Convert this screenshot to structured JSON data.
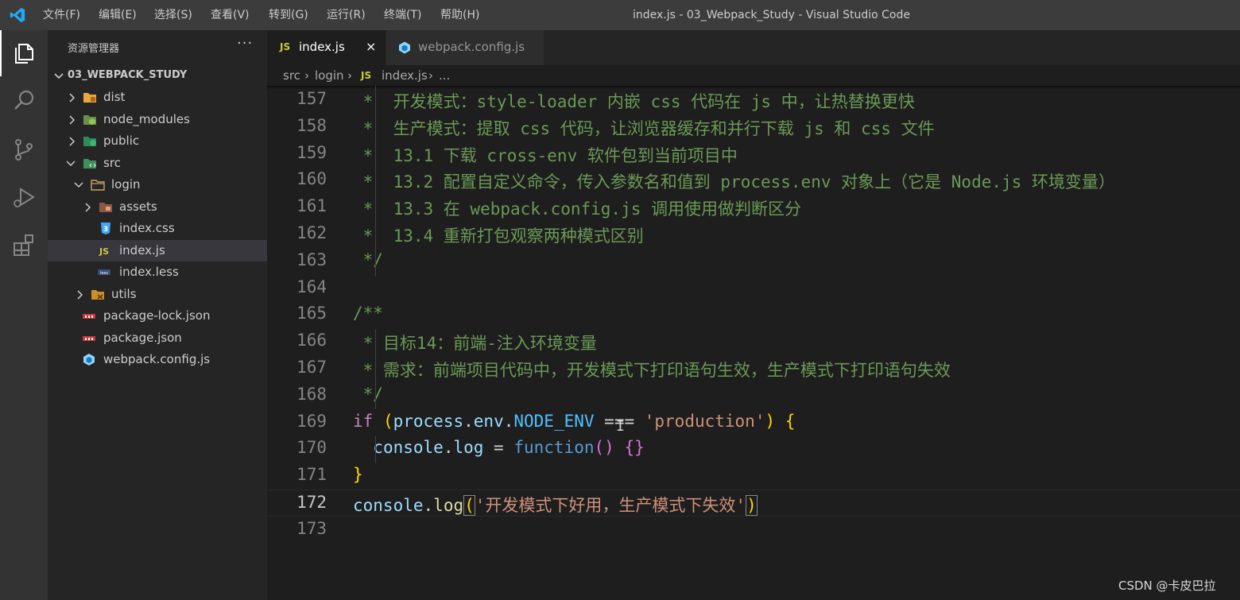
{
  "window": {
    "title": "index.js - 03_Webpack_Study - Visual Studio Code",
    "menu": [
      "文件(F)",
      "编辑(E)",
      "选择(S)",
      "查看(V)",
      "转到(G)",
      "运行(R)",
      "终端(T)",
      "帮助(H)"
    ]
  },
  "activity_bar": [
    "files-icon",
    "search-icon",
    "source-control-icon",
    "run-debug-icon",
    "extensions-icon"
  ],
  "sidebar": {
    "title": "资源管理器",
    "more": "···",
    "project": "03_WEBPACK_STUDY",
    "tree": [
      {
        "label": "dist",
        "icon": "folder-dist-icon",
        "expanded": false
      },
      {
        "label": "node_modules",
        "icon": "folder-node-icon",
        "expanded": false
      },
      {
        "label": "public",
        "icon": "folder-public-icon",
        "expanded": false
      },
      {
        "label": "src",
        "icon": "folder-src-icon",
        "expanded": true
      },
      {
        "label": "login",
        "icon": "folder-icon",
        "expanded": true
      },
      {
        "label": "assets",
        "icon": "folder-assets-icon",
        "expanded": false
      },
      {
        "label": "index.css",
        "icon": "css-file-icon"
      },
      {
        "label": "index.js",
        "icon": "js-file-icon",
        "selected": true
      },
      {
        "label": "index.less",
        "icon": "less-file-icon"
      },
      {
        "label": "utils",
        "icon": "folder-utils-icon",
        "expanded": false
      },
      {
        "label": "package-lock.json",
        "icon": "npm-file-icon"
      },
      {
        "label": "package.json",
        "icon": "npm-file-icon"
      },
      {
        "label": "webpack.config.js",
        "icon": "webpack-file-icon"
      }
    ]
  },
  "tabs": [
    {
      "badge": "JS",
      "label": "index.js",
      "active": true,
      "close": "×"
    },
    {
      "label": "webpack.config.js",
      "active": false
    }
  ],
  "breadcrumb": {
    "items": [
      "src",
      "login",
      "index.js",
      "..."
    ],
    "file_badge": "JS",
    "separator": "›"
  },
  "editor": {
    "current_line": 172,
    "lines": [
      {
        "n": "157",
        "text": " *  开发模式：style-loader 内嵌 css 代码在 js 中，让热替换更快"
      },
      {
        "n": "158",
        "text": " *  生产模式：提取 css 代码，让浏览器缓存和并行下载 js 和 css 文件"
      },
      {
        "n": "159",
        "text": " *  13.1 下载 cross-env 软件包到当前项目中"
      },
      {
        "n": "160",
        "text": " *  13.2 配置自定义命令，传入参数名和值到 process.env 对象上（它是 Node.js 环境变量）"
      },
      {
        "n": "161",
        "text": " *  13.3 在 webpack.config.js 调用使用做判断区分"
      },
      {
        "n": "162",
        "text": " *  13.4 重新打包观察两种模式区别"
      },
      {
        "n": "163",
        "text": " */"
      },
      {
        "n": "164",
        "text": ""
      },
      {
        "n": "165",
        "text": "/**"
      },
      {
        "n": "166",
        "text": " * 目标14：前端-注入环境变量"
      },
      {
        "n": "167",
        "text": " * 需求：前端项目代码中，开发模式下打印语句生效，生产模式下打印语句失效"
      },
      {
        "n": "168",
        "text": " */"
      },
      {
        "n": "169",
        "tokens": [
          {
            "t": "if",
            "c": "c-kw"
          },
          {
            "t": " ",
            "c": "c-op"
          },
          {
            "t": "(",
            "c": "c-br1"
          },
          {
            "t": "process",
            "c": "c-var"
          },
          {
            "t": ".",
            "c": "c-op"
          },
          {
            "t": "env",
            "c": "c-var"
          },
          {
            "t": ".",
            "c": "c-op"
          },
          {
            "t": "NODE_ENV",
            "c": "c-const"
          },
          {
            "t": " === ",
            "c": "c-op"
          },
          {
            "t": "'production'",
            "c": "c-str"
          },
          {
            "t": ")",
            "c": "c-br1"
          },
          {
            "t": " ",
            "c": "c-op"
          },
          {
            "t": "{",
            "c": "c-br1"
          }
        ]
      },
      {
        "n": "170",
        "tokens": [
          {
            "t": "  ",
            "c": "c-op"
          },
          {
            "t": "console",
            "c": "c-var"
          },
          {
            "t": ".",
            "c": "c-op"
          },
          {
            "t": "log",
            "c": "c-var"
          },
          {
            "t": " = ",
            "c": "c-op"
          },
          {
            "t": "function",
            "c": "c-kw2"
          },
          {
            "t": "()",
            "c": "c-br2"
          },
          {
            "t": " ",
            "c": "c-op"
          },
          {
            "t": "{}",
            "c": "c-br2"
          }
        ]
      },
      {
        "n": "171",
        "tokens": [
          {
            "t": "}",
            "c": "c-br1"
          }
        ]
      },
      {
        "n": "172",
        "tokens": [
          {
            "t": "console",
            "c": "c-var"
          },
          {
            "t": ".",
            "c": "c-op"
          },
          {
            "t": "log",
            "c": "c-fn"
          },
          {
            "t": "(",
            "c": "c-br1 bracket-box"
          },
          {
            "t": "'开发模式下好用，生产模式下失效'",
            "c": "c-str"
          },
          {
            "t": ")",
            "c": "c-br1 bracket-box"
          }
        ]
      },
      {
        "n": "173",
        "text": ""
      }
    ]
  },
  "watermark": "CSDN @卡皮巴拉",
  "colors": {
    "titlebar": "#3c3c3c",
    "activitybar": "#333333",
    "sidebar": "#252526",
    "editor": "#1e1e1e",
    "comment": "#6a9955",
    "keyword": "#c586c0",
    "string": "#ce9178"
  }
}
